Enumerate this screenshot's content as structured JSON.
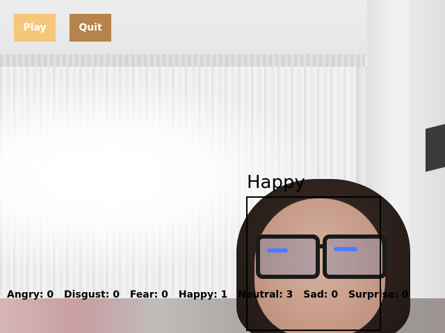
{
  "buttons": {
    "play_label": "Play",
    "quit_label": "Quit",
    "play_color": "#f5c77a",
    "quit_color": "#b6834c"
  },
  "detection": {
    "label": "Happy",
    "box_color": "#000000"
  },
  "emotion_counts": [
    {
      "text": "Angry: 0"
    },
    {
      "text": "Disgust: 0"
    },
    {
      "text": "Fear: 0"
    },
    {
      "text": "Happy: 1"
    },
    {
      "text": "Neutral: 3"
    },
    {
      "text": "Sad: 0"
    },
    {
      "text": "Surprise: 0"
    }
  ]
}
